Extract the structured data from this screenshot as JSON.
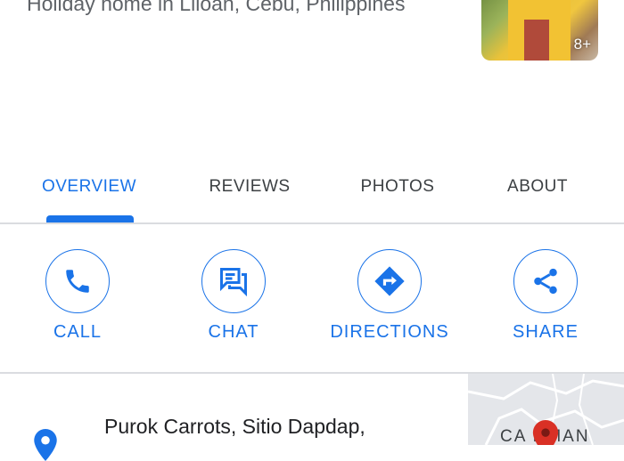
{
  "place": {
    "subtitle": "Holiday home in Liloan, Cebu, Philippines",
    "photo_count": "8+"
  },
  "tabs": [
    {
      "label": "OVERVIEW",
      "active": true
    },
    {
      "label": "REVIEWS",
      "active": false
    },
    {
      "label": "PHOTOS",
      "active": false
    },
    {
      "label": "ABOUT",
      "active": false
    }
  ],
  "actions": [
    {
      "label": "CALL",
      "icon": "phone-icon"
    },
    {
      "label": "CHAT",
      "icon": "chat-icon"
    },
    {
      "label": "DIRECTIONS",
      "icon": "directions-icon"
    },
    {
      "label": "SHARE",
      "icon": "share-icon"
    }
  ],
  "address": {
    "line": "Purok Carrots, Sitio Dapdap,"
  },
  "map": {
    "label": "CA  RMAN"
  },
  "colors": {
    "accent": "#1a73e8",
    "divider": "#dadce0",
    "map_pin": "#d93025"
  }
}
